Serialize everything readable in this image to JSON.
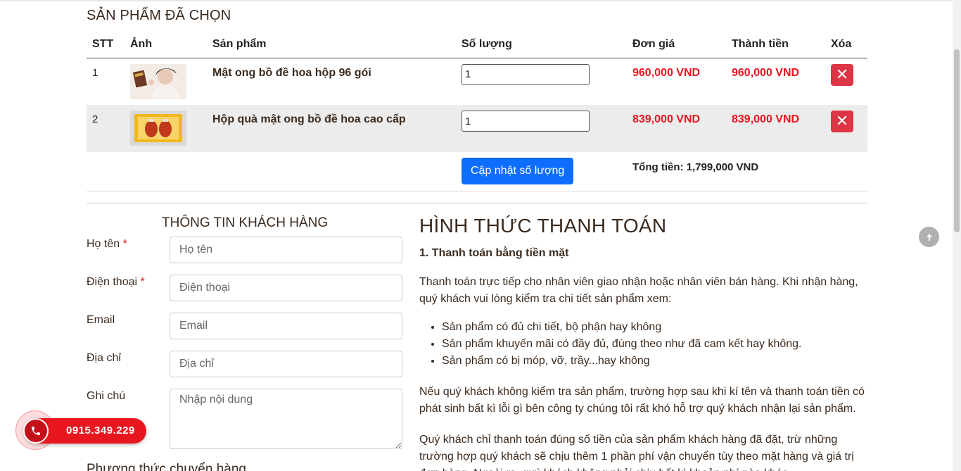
{
  "cart": {
    "title": "SẢN PHẨM ĐÃ CHỌN",
    "headers": [
      "STT",
      "Ảnh",
      "Sản phẩm",
      "Số lượng",
      "Đơn giá",
      "Thành tiền",
      "Xóa"
    ],
    "items": [
      {
        "index": "1",
        "name": "Mật ong bồ đề hoa hộp 96 gói",
        "quantity": "1",
        "unit_price": "960,000 VND",
        "total": "960,000 VND"
      },
      {
        "index": "2",
        "name": "Hộp quà mật ong bồ đề hoa cao cấp",
        "quantity": "1",
        "unit_price": "839,000 VND",
        "total": "839,000 VND"
      }
    ],
    "update_label": "Cập nhật số lượng",
    "grand_total": "Tổng tiền: 1,799,000 VND",
    "delete_symbol": "✕"
  },
  "customer": {
    "title": "THÔNG TIN KHÁCH HÀNG",
    "fields": [
      {
        "label": "Họ tên",
        "required": "*",
        "placeholder": "Họ tên"
      },
      {
        "label": "Điện thoại",
        "required": "*",
        "placeholder": "Điện thoại"
      },
      {
        "label": "Email",
        "required": "",
        "placeholder": "Email"
      },
      {
        "label": "Địa chỉ",
        "required": "",
        "placeholder": "Địa chỉ"
      },
      {
        "label": "Ghi chú",
        "required": "",
        "placeholder": "Nhập nội dung"
      }
    ],
    "shipping_title": "Phương thức chuyển hàng"
  },
  "payment": {
    "title": "HÌNH THỨC THANH TOÁN",
    "method_1": "1. Thanh toán bằng tiền mặt",
    "intro": "Thanh toán trực tiếp cho nhân viên giao nhận hoặc nhân viên bán hàng. Khi nhận hàng, quý khách vui lòng kiểm tra chi tiết sản phẩm xem:",
    "checklist": [
      "Sản phẩm có đủ chi tiết, bộ phận hay không",
      "Sản phẩm khuyến mãi có đầy đủ, đúng theo như đã cam kết hay không.",
      "Sản phẩm có bị móp, vỡ, trầy...hay không"
    ],
    "note_1": "Nếu quý khách không kiểm tra sản phẩm, trường hợp sau khi kí tên và thanh toán tiền có phát sinh bất kì lỗi gì bên công ty chúng tôi rất khó hỗ trợ quý khách nhận lại sản phẩm.",
    "note_2": "Quý khách chỉ thanh toán đúng số tiền của sản phẩm khách hàng đã đặt, trừ những trường hợp quý khách sẽ chịu thêm 1 phần phí vận chuyển tùy theo mặt hàng và giá trị đơn hàng. Ngoài ra, quý khách không phải chịu bất kì khoản phí nào khác."
  },
  "hotline": {
    "number": "0915.349.229"
  },
  "colors": {
    "accent_red": "#e8161f",
    "button_blue": "#0d6efd",
    "delete_red": "#dc3545",
    "heading_brown": "#3b2a1e"
  }
}
